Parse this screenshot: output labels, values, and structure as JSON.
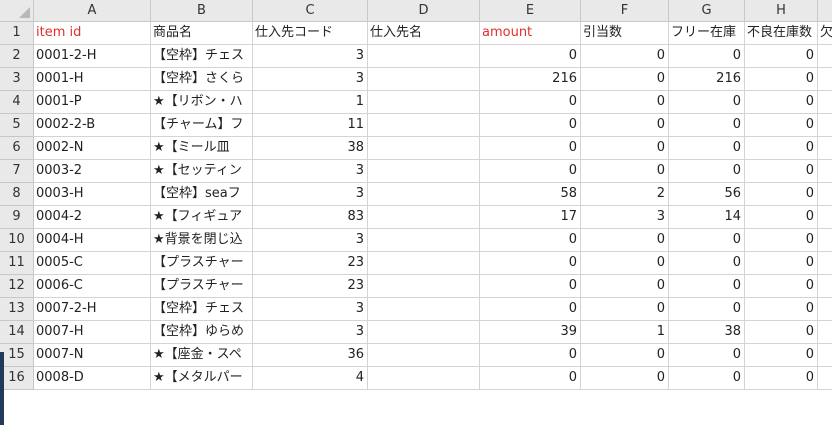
{
  "columns": [
    "A",
    "B",
    "C",
    "D",
    "E",
    "F",
    "G",
    "H"
  ],
  "row_numbers": [
    "1",
    "2",
    "3",
    "4",
    "5",
    "6",
    "7",
    "8",
    "9",
    "10",
    "11",
    "12",
    "13",
    "14",
    "15",
    "16"
  ],
  "header_row": {
    "A": "item id",
    "B": "商品名",
    "C": "仕入先コード",
    "D": "仕入先名",
    "E": "amount",
    "F": "引当数",
    "G": "フリー在庫",
    "H": "不良在庫数",
    "I": "欠"
  },
  "header_colors": {
    "accent_red": "#e0302a"
  },
  "rows": [
    {
      "A": "0001-2-H",
      "B": "【空枠】チェス",
      "C": "3",
      "E": "0",
      "F": "0",
      "G": "0",
      "H": "0"
    },
    {
      "A": "0001-H",
      "B": "【空枠】さくら",
      "C": "3",
      "E": "216",
      "F": "0",
      "G": "216",
      "H": "0"
    },
    {
      "A": "0001-P",
      "B": "★【リボン・ハ",
      "C": "1",
      "E": "0",
      "F": "0",
      "G": "0",
      "H": "0"
    },
    {
      "A": "0002-2-B",
      "B": "【チャーム】フ",
      "C": "11",
      "E": "0",
      "F": "0",
      "G": "0",
      "H": "0"
    },
    {
      "A": "0002-N",
      "B": "★【ミール皿",
      "C": "38",
      "E": "0",
      "F": "0",
      "G": "0",
      "H": "0"
    },
    {
      "A": "0003-2",
      "B": "★【セッティン",
      "C": "3",
      "E": "0",
      "F": "0",
      "G": "0",
      "H": "0"
    },
    {
      "A": "0003-H",
      "B": "【空枠】seaフ",
      "C": "3",
      "E": "58",
      "F": "2",
      "G": "56",
      "H": "0"
    },
    {
      "A": "0004-2",
      "B": "★【フィギュア",
      "C": "83",
      "E": "17",
      "F": "3",
      "G": "14",
      "H": "0"
    },
    {
      "A": "0004-H",
      "B": "★背景を閉じ込",
      "C": "3",
      "E": "0",
      "F": "0",
      "G": "0",
      "H": "0"
    },
    {
      "A": "0005-C",
      "B": "【プラスチャー",
      "C": "23",
      "E": "0",
      "F": "0",
      "G": "0",
      "H": "0"
    },
    {
      "A": "0006-C",
      "B": "【プラスチャー",
      "C": "23",
      "E": "0",
      "F": "0",
      "G": "0",
      "H": "0"
    },
    {
      "A": "0007-2-H",
      "B": "【空枠】チェス",
      "C": "3",
      "E": "0",
      "F": "0",
      "G": "0",
      "H": "0"
    },
    {
      "A": "0007-H",
      "B": "【空枠】ゆらめ",
      "C": "3",
      "E": "39",
      "F": "1",
      "G": "38",
      "H": "0"
    },
    {
      "A": "0007-N",
      "B": "★【座金・スペ",
      "C": "36",
      "E": "0",
      "F": "0",
      "G": "0",
      "H": "0"
    },
    {
      "A": "0008-D",
      "B": "★【メタルパー",
      "C": "4",
      "E": "0",
      "F": "0",
      "G": "0",
      "H": "0"
    }
  ]
}
